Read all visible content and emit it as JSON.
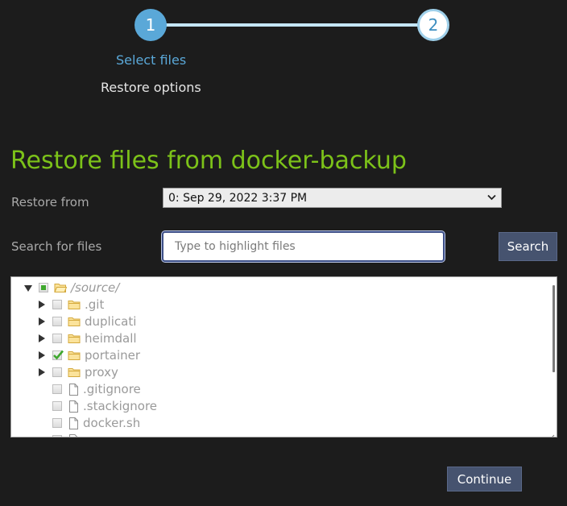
{
  "stepper": {
    "steps": [
      {
        "number": "1",
        "label": "Select files"
      },
      {
        "number": "2",
        "label": "Restore options"
      }
    ]
  },
  "page_title": "Restore files from docker-backup",
  "restore_from": {
    "label": "Restore from",
    "selected": "0: Sep 29, 2022 3:37 PM"
  },
  "search": {
    "label": "Search for files",
    "placeholder": "Type to highlight files",
    "value": "",
    "button_label": "Search"
  },
  "tree": {
    "root": {
      "name": "/source/",
      "state": "partial",
      "expanded": true,
      "icon": "folder-open-icon"
    },
    "items": [
      {
        "name": ".git",
        "type": "folder",
        "checked": false
      },
      {
        "name": "duplicati",
        "type": "folder",
        "checked": false
      },
      {
        "name": "heimdall",
        "type": "folder",
        "checked": false
      },
      {
        "name": "portainer",
        "type": "folder",
        "checked": true
      },
      {
        "name": "proxy",
        "type": "folder",
        "checked": false
      },
      {
        "name": ".gitignore",
        "type": "file",
        "checked": false
      },
      {
        "name": ".stackignore",
        "type": "file",
        "checked": false
      },
      {
        "name": "docker.sh",
        "type": "file",
        "checked": false
      }
    ]
  },
  "continue_label": "Continue",
  "colors": {
    "accent_blue": "#5aa8d8",
    "title_green": "#7cc219",
    "button_bg": "#46536f",
    "background": "#1c1c1c"
  }
}
